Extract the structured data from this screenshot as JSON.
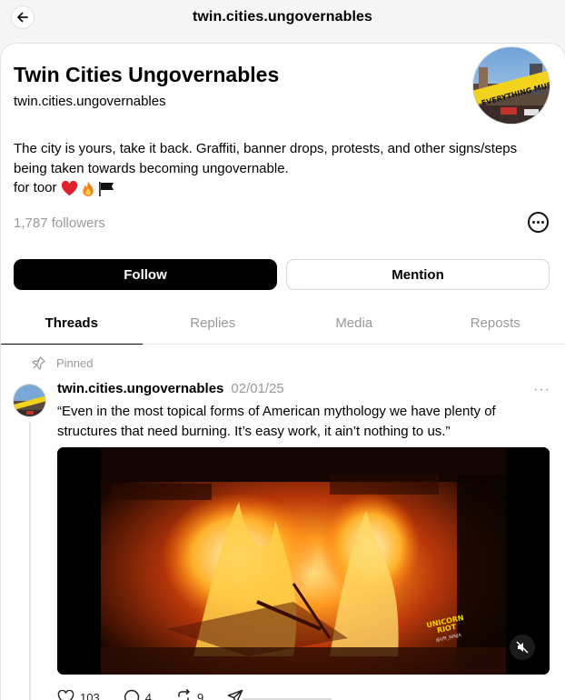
{
  "topbar": {
    "title": "twin.cities.ungovernables"
  },
  "profile": {
    "name": "Twin Cities Ungovernables",
    "handle": "twin.cities.ungovernables",
    "bio_line1": "The city is yours, take it back. Graffiti, banner drops, protests, and other signs/steps",
    "bio_line2": "being taken towards becoming ungovernable.",
    "bio_line3": "for toor",
    "bio_emojis": [
      "red-heart",
      "fire",
      "black-flag"
    ],
    "followers": "1,787 followers"
  },
  "buttons": {
    "follow": "Follow",
    "mention": "Mention"
  },
  "tabs": [
    {
      "label": "Threads",
      "active": true
    },
    {
      "label": "Replies",
      "active": false
    },
    {
      "label": "Media",
      "active": false
    },
    {
      "label": "Reposts",
      "active": false
    }
  ],
  "post": {
    "pinned_label": "Pinned",
    "username": "twin.cities.ungovernables",
    "date": "02/01/25",
    "text_line1": "“Even in the most topical forms of American mythology we have plenty of",
    "text_line2": "structures that need burning. It’s easy work, it ain’t nothing to us.”",
    "video_watermark": "UNICORN RIOT",
    "video_watermark_sub": "@UR_NINJA",
    "likes": "103",
    "replies": "4",
    "reposts": "9"
  },
  "colors": {
    "muted_text": "#999999",
    "accent_button": "#000000",
    "card_background": "#ffffff",
    "page_background": "#f5f5f5"
  }
}
